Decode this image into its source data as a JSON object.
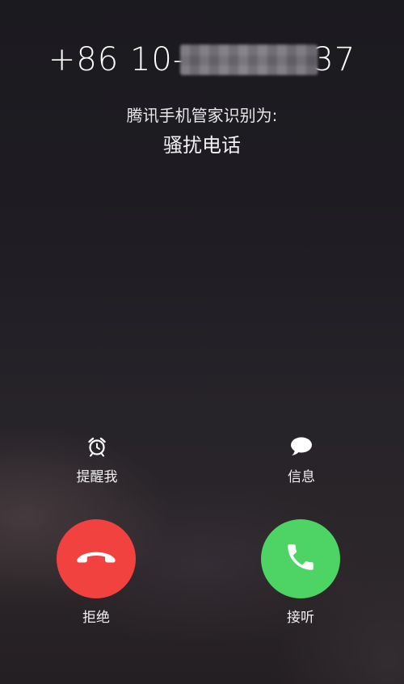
{
  "caller": {
    "number_prefix": "+86 10-",
    "number_suffix": "37",
    "identified_by": "腾讯手机管家识别为:",
    "caller_type": "骚扰电话"
  },
  "actions": {
    "remind_label": "提醒我",
    "message_label": "信息",
    "decline_label": "拒绝",
    "accept_label": "接听"
  },
  "icons": {
    "remind": "alarm-clock-icon",
    "message": "speech-bubble-icon",
    "decline": "phone-hangup-icon",
    "accept": "phone-icon"
  },
  "colors": {
    "decline": "#f2423f",
    "accept": "#4dd464"
  }
}
